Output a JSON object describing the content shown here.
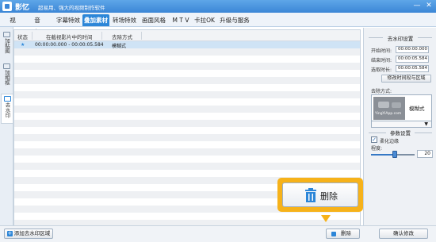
{
  "window": {
    "app_name": "影忆",
    "slogan": "超易用、强大的视频制作软件",
    "minimize": "—",
    "close": "✕"
  },
  "menu": {
    "tabs": [
      "视　频",
      "音　频",
      "字幕特效",
      "叠加素材",
      "转场特效",
      "画面风格",
      "M T V",
      "卡拉OK",
      "升级与服务"
    ],
    "active": "叠加素材"
  },
  "sidebar": {
    "items": [
      {
        "label": "加贴图"
      },
      {
        "label": "加相框"
      },
      {
        "label": "去水印"
      }
    ],
    "active": "去水印"
  },
  "table": {
    "columns": [
      "状态",
      "在截视影片中的时间",
      "去除方式"
    ],
    "rows": [
      {
        "status": "★",
        "time": "00:00:00.000 - 00:00:05.584",
        "method": "模糊式"
      }
    ]
  },
  "right_panel": {
    "section1_title": "去水印设置",
    "start_label": "开始时间:",
    "start_value": "00:00:00.000",
    "end_label": "结束时间:",
    "end_value": "00:00:05.584",
    "duration_label": "选取时长:",
    "duration_value": "00:00:05.584",
    "modify_button": "修改时间段与区域",
    "removal_label": "去除方式:",
    "thumb_text": "YingYiApp.com",
    "style_label": "模糊式",
    "dropdown_arrow": "▼",
    "section2_title": "参数设置",
    "soften_label": "柔化边缘",
    "soften_checked": "✓",
    "degree_label": "程度:",
    "degree_value": "20",
    "degree_fraction": 0.55
  },
  "bottom": {
    "add_button": "添加去水印区域",
    "delete_button": "删除",
    "confirm_button": "确认修改"
  },
  "callout": {
    "label": "删除"
  },
  "colors": {
    "accent": "#2c86d8",
    "callout": "#f6b21a"
  }
}
